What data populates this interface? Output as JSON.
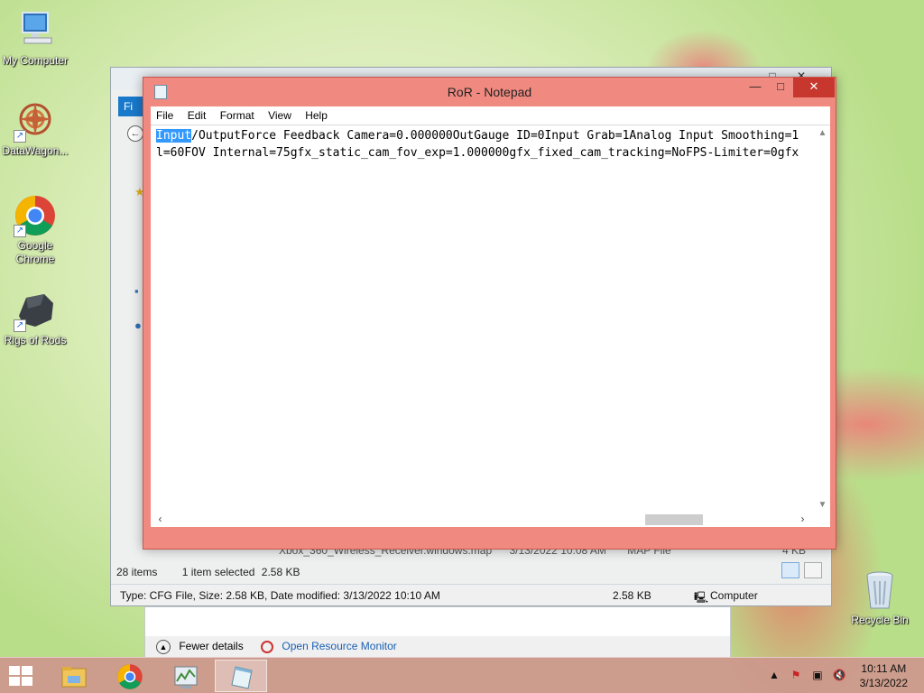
{
  "desktop": {
    "icons": [
      {
        "label": "My Computer",
        "icon": "computer-icon"
      },
      {
        "label": "DataWagon...",
        "icon": "datawagon-icon"
      },
      {
        "label": "Google Chrome",
        "icon": "chrome-icon"
      },
      {
        "label": "Rigs of Rods",
        "icon": "rigs-of-rods-icon"
      },
      {
        "label": "Recycle Bin",
        "icon": "recycle-bin-icon"
      }
    ]
  },
  "explorer": {
    "ribbon_tab": "Fi",
    "partial_file": "Xbox_360_Wireless_Receiver.windows.map",
    "partial_date": "3/13/2022 10:08 AM",
    "partial_type": "MAP File",
    "partial_size": "4 KB",
    "item_count": "28 items",
    "selection": "1 item selected",
    "selection_size": "2.58 KB",
    "details_info": "Type: CFG File, Size: 2.58 KB, Date modified: 3/13/2022 10:10 AM",
    "details_size": "2.58 KB",
    "details_location": "Computer"
  },
  "task_manager": {
    "fewer_details": "Fewer details",
    "open_resource_monitor": "Open Resource Monitor"
  },
  "notepad": {
    "title": "RoR - Notepad",
    "controls": {
      "minimize": "—",
      "maximize": "□",
      "close": "✕"
    },
    "menu": [
      "File",
      "Edit",
      "Format",
      "View",
      "Help"
    ],
    "selected_text": "Input",
    "line1_rest": "/OutputForce Feedback Camera=0.000000OutGauge ID=0Input Grab=1Analog Input Smoothing=1",
    "line2": "l=60FOV Internal=75gfx_static_cam_fov_exp=1.000000gfx_fixed_cam_tracking=NoFPS-Limiter=0gfx"
  },
  "taskbar": {
    "apps": [
      {
        "name": "File Explorer",
        "icon": "file-explorer-icon",
        "active": false
      },
      {
        "name": "Google Chrome",
        "icon": "chrome-icon",
        "active": false
      },
      {
        "name": "Task Manager",
        "icon": "task-manager-icon",
        "active": false
      },
      {
        "name": "Notepad",
        "icon": "notepad-icon",
        "active": true
      }
    ],
    "tray": [
      "show-hidden-icons",
      "action-center-flag-icon",
      "network-icon",
      "volume-muted-icon"
    ],
    "time": "10:11 AM",
    "date": "3/13/2022"
  }
}
